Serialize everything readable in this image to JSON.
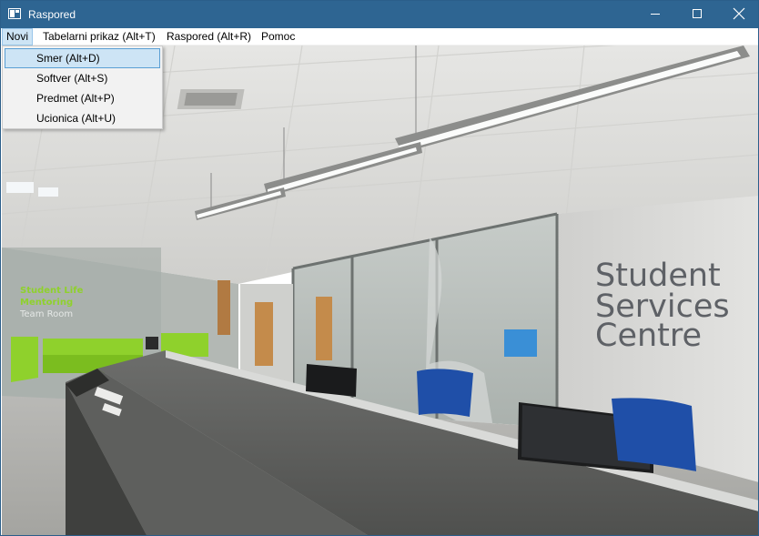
{
  "window": {
    "title": "Raspored",
    "controls": {
      "minimize_icon": "minimize-icon",
      "maximize_icon": "maximize-icon",
      "close_icon": "close-icon"
    }
  },
  "menubar": {
    "items": [
      {
        "label": "Novi",
        "open": true
      },
      {
        "label": "Tabelarni prikaz (Alt+T)"
      },
      {
        "label": "Raspored (Alt+R)"
      },
      {
        "label": "Pomoc"
      }
    ]
  },
  "dropdown": {
    "items": [
      {
        "label": "Smer (Alt+D)",
        "highlighted": true
      },
      {
        "label": "Softver (Alt+S)"
      },
      {
        "label": "Predmet (Alt+P)"
      },
      {
        "label": "Ucionica (Alt+U)"
      }
    ]
  },
  "background": {
    "wall_sign_lines": [
      "Student",
      "Services",
      "Centre"
    ],
    "glass_sign_lines": [
      "Student Life",
      "Mentoring",
      "Team Room"
    ]
  },
  "colors": {
    "titlebar": "#2e6592",
    "menu_highlight": "#cde4f5",
    "menu_highlight_border": "#5a9fd4",
    "sofa": "#8fd12c",
    "chair": "#1f4fa8"
  }
}
